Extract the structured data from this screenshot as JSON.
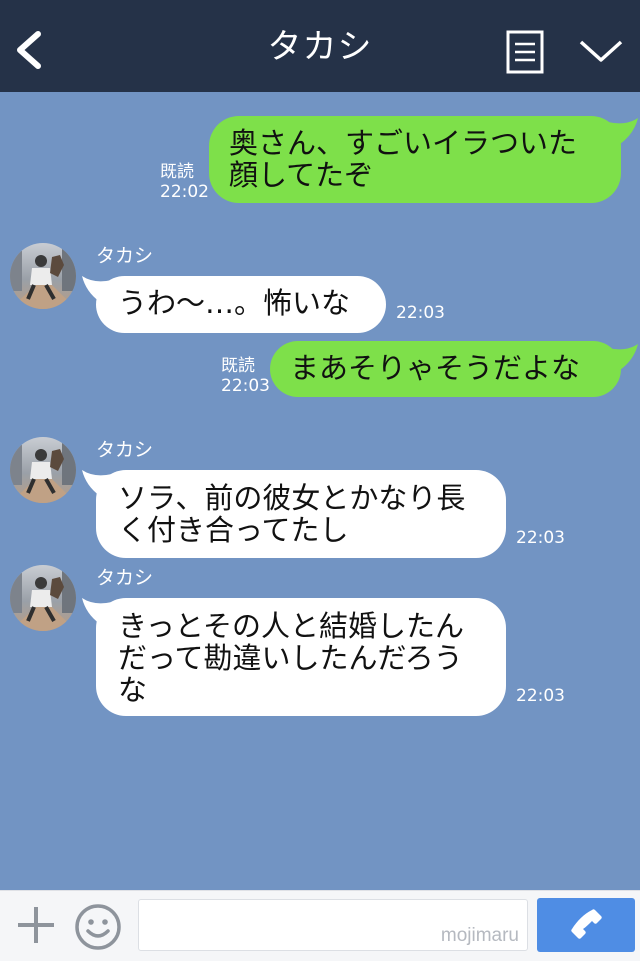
{
  "header": {
    "title": "タカシ"
  },
  "messages": [
    {
      "lines": [
        "奥さん、すごいイラついた",
        "顔してたぞ"
      ],
      "status": "既読",
      "time": "22:02"
    },
    {
      "sender": "タカシ",
      "lines": [
        "うわ〜…。怖いな"
      ],
      "time": "22:03"
    },
    {
      "lines": [
        "まあそりゃそうだよな"
      ],
      "status": "既読",
      "time": "22:03"
    },
    {
      "sender": "タカシ",
      "lines": [
        "ソラ、前の彼女とかなり長",
        "く付き合ってたし"
      ],
      "time": "22:03"
    },
    {
      "sender": "タカシ",
      "lines": [
        "きっとその人と結婚したん",
        "だって勘違いしたんだろう",
        "な"
      ],
      "time": "22:03"
    }
  ],
  "footer": {
    "watermark": "mojimaru"
  },
  "colors": {
    "header": "#253248",
    "background": "#7294c3",
    "outgoing": "#7ee04a",
    "incoming": "#ffffff",
    "send": "#4f8de4"
  },
  "icons": [
    "back-arrow-icon",
    "menu-icon",
    "chevron-down-icon",
    "plus-icon",
    "smile-icon",
    "phone-icon"
  ]
}
